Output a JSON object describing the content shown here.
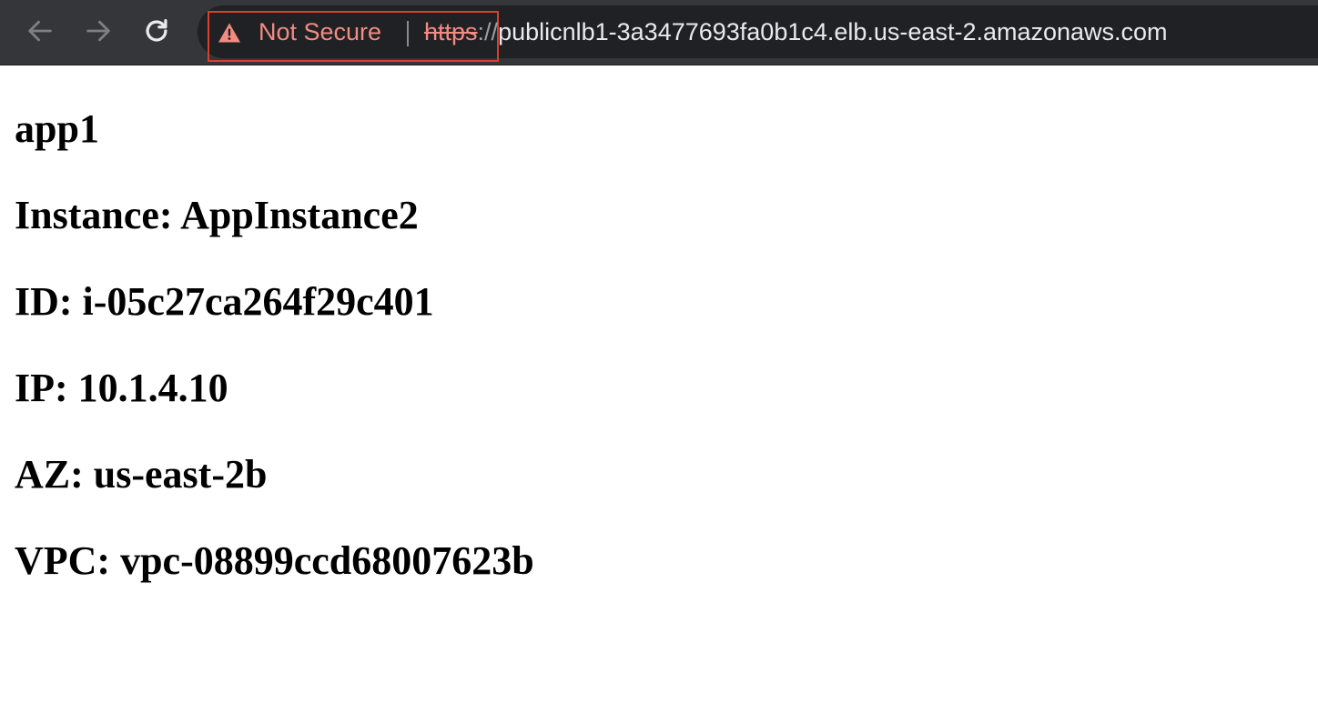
{
  "browser": {
    "security_label": "Not Secure",
    "url": {
      "scheme": "https",
      "separator": "://",
      "host": "publicnlb1-3a3477693fa0b1c4.elb.us-east-2.amazonaws.com"
    },
    "icons": {
      "back": "arrow-left-icon",
      "forward": "arrow-right-icon",
      "reload": "reload-icon",
      "warning": "warning-triangle-icon"
    },
    "colors": {
      "toolbar": "#35363a",
      "omnibox": "#202124",
      "warning_text": "#f28b82",
      "highlight_box": "#d9402b"
    }
  },
  "page": {
    "app_name": "app1",
    "instance_line": "Instance: AppInstance2",
    "id_line": "ID: i-05c27ca264f29c401",
    "ip_line": "IP: 10.1.4.10",
    "az_line": "AZ: us-east-2b",
    "vpc_line": "VPC: vpc-08899ccd68007623b"
  }
}
